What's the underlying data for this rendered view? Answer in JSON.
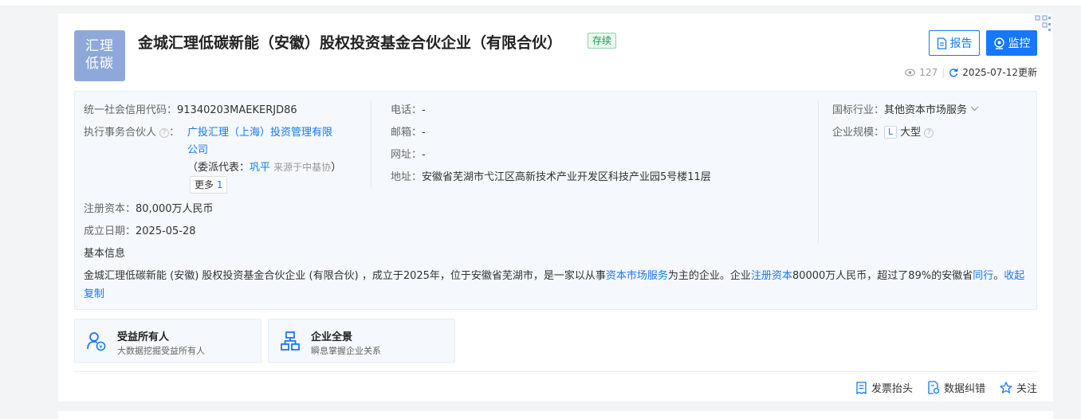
{
  "company": {
    "logo_line1": "汇理",
    "logo_line2": "低碳",
    "name": "金城汇理低碳新能（安徽）股权投资基金合伙企业（有限合伙）",
    "status": "存续"
  },
  "header": {
    "report_label": "报告",
    "monitor_label": "监控",
    "views": "127",
    "updated": "2025-07-12更新"
  },
  "info": {
    "credit_code_label": "统一社会信用代码：",
    "credit_code": "91340203MAEKERJD86",
    "partner_label": "执行事务合伙人",
    "partner_line1": "广投汇理（上海）投资管理有限",
    "partner_line2": "公司",
    "rep_prefix": "（委派代表：",
    "rep_name": "巩平",
    "rep_source": "来源于中基协",
    "rep_suffix": "）",
    "more_label": "更多",
    "more_count": "1",
    "capital_label": "注册资本：",
    "capital": "80,000万人民币",
    "date_label": "成立日期：",
    "date": "2025-05-28",
    "phone_label": "电话：",
    "phone": "-",
    "email_label": "邮箱：",
    "email": "-",
    "website_label": "网址：",
    "website": "-",
    "address_label": "地址：",
    "address": "安徽省芜湖市弋江区高新技术产业开发区科技产业园5号楼11层",
    "industry_label": "国标行业：",
    "industry": "其他资本市场服务",
    "scale_label": "企业规模：",
    "scale_badge": "L",
    "scale": "大型",
    "basic_title": "基本信息",
    "desc_part1": "金城汇理低碳新能 (安徽) 股权投资基金合伙企业 (有限合伙) ，成立于2025年，位于安徽省芜湖市，是一家以从事",
    "desc_link1": "资本市场服务",
    "desc_part2": "为主的企业。企业",
    "desc_link2": "注册资本",
    "desc_part3": "80000万人民币，超过了89%的安徽省",
    "desc_link3": "同行",
    "desc_part4": "。",
    "collapse": "收起",
    "copy": "复制"
  },
  "features": [
    {
      "title": "受益所有人",
      "subtitle": "大数据挖掘受益所有人",
      "icon": "beneficiary-icon"
    },
    {
      "title": "企业全景",
      "subtitle": "瞬息掌握企业关系",
      "icon": "org-chart-icon"
    }
  ],
  "actions": {
    "invoice": "发票抬头",
    "correction": "数据纠错",
    "follow": "关注"
  },
  "colors": {
    "brand": "#1677ff",
    "status_green": "#1a9a4d",
    "logo_bg": "#8ea9d9"
  }
}
